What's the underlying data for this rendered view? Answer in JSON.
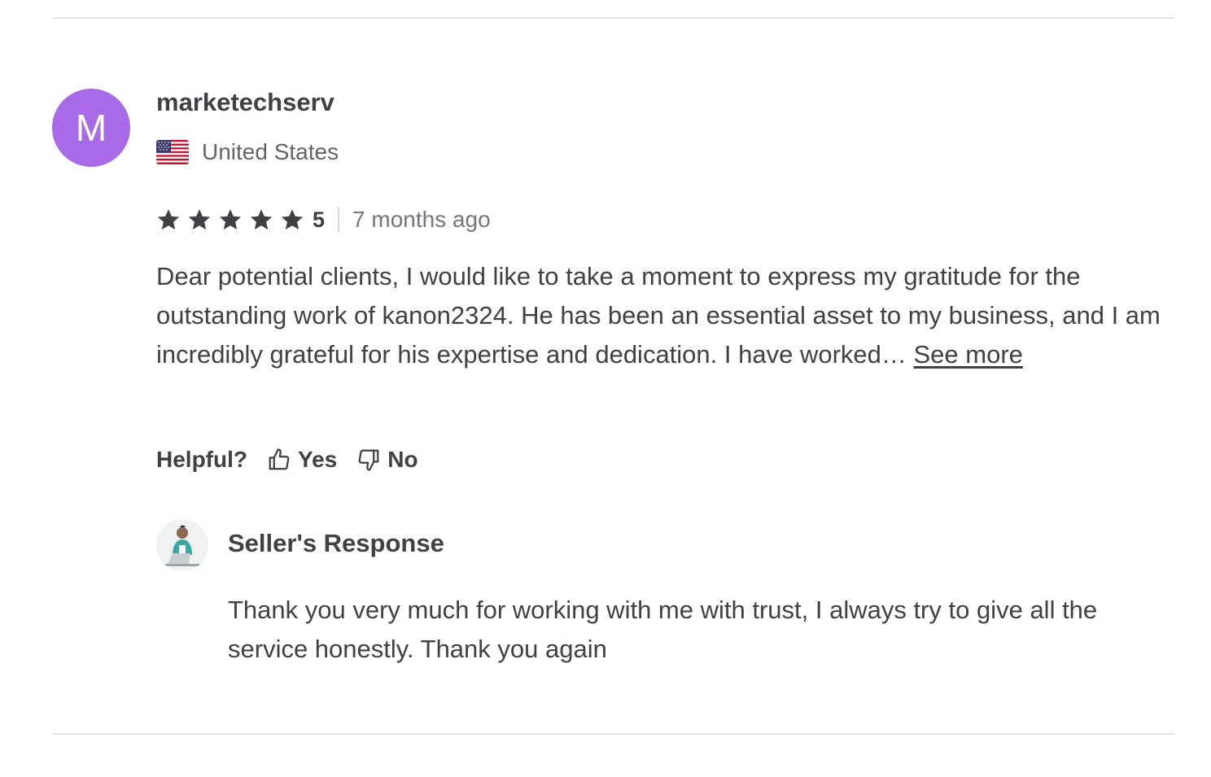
{
  "review": {
    "avatar_initial": "M",
    "avatar_color": "#a86ae6",
    "username": "marketechserv",
    "country": "United States",
    "country_flag_icon": "us-flag-icon",
    "rating_stars": 5,
    "rating_value": "5",
    "time_ago": "7 months ago",
    "text": "Dear potential clients, I would like to take a moment to express my gratitude for the outstanding work of kanon2324. He has been an essential asset to my business, and I am incredibly grateful for his expertise and dedication. I have worked… ",
    "see_more_label": "See more"
  },
  "helpful": {
    "label": "Helpful?",
    "yes_label": "Yes",
    "yes_icon": "thumbs-up-icon",
    "no_label": "No",
    "no_icon": "thumbs-down-icon"
  },
  "seller_response": {
    "title": "Seller's Response",
    "text": "Thank you very much for working with me with trust, I always try to give all the service honestly. Thank you again"
  },
  "colors": {
    "text": "#404145",
    "muted": "#62646a",
    "divider": "#e4e5e7"
  }
}
